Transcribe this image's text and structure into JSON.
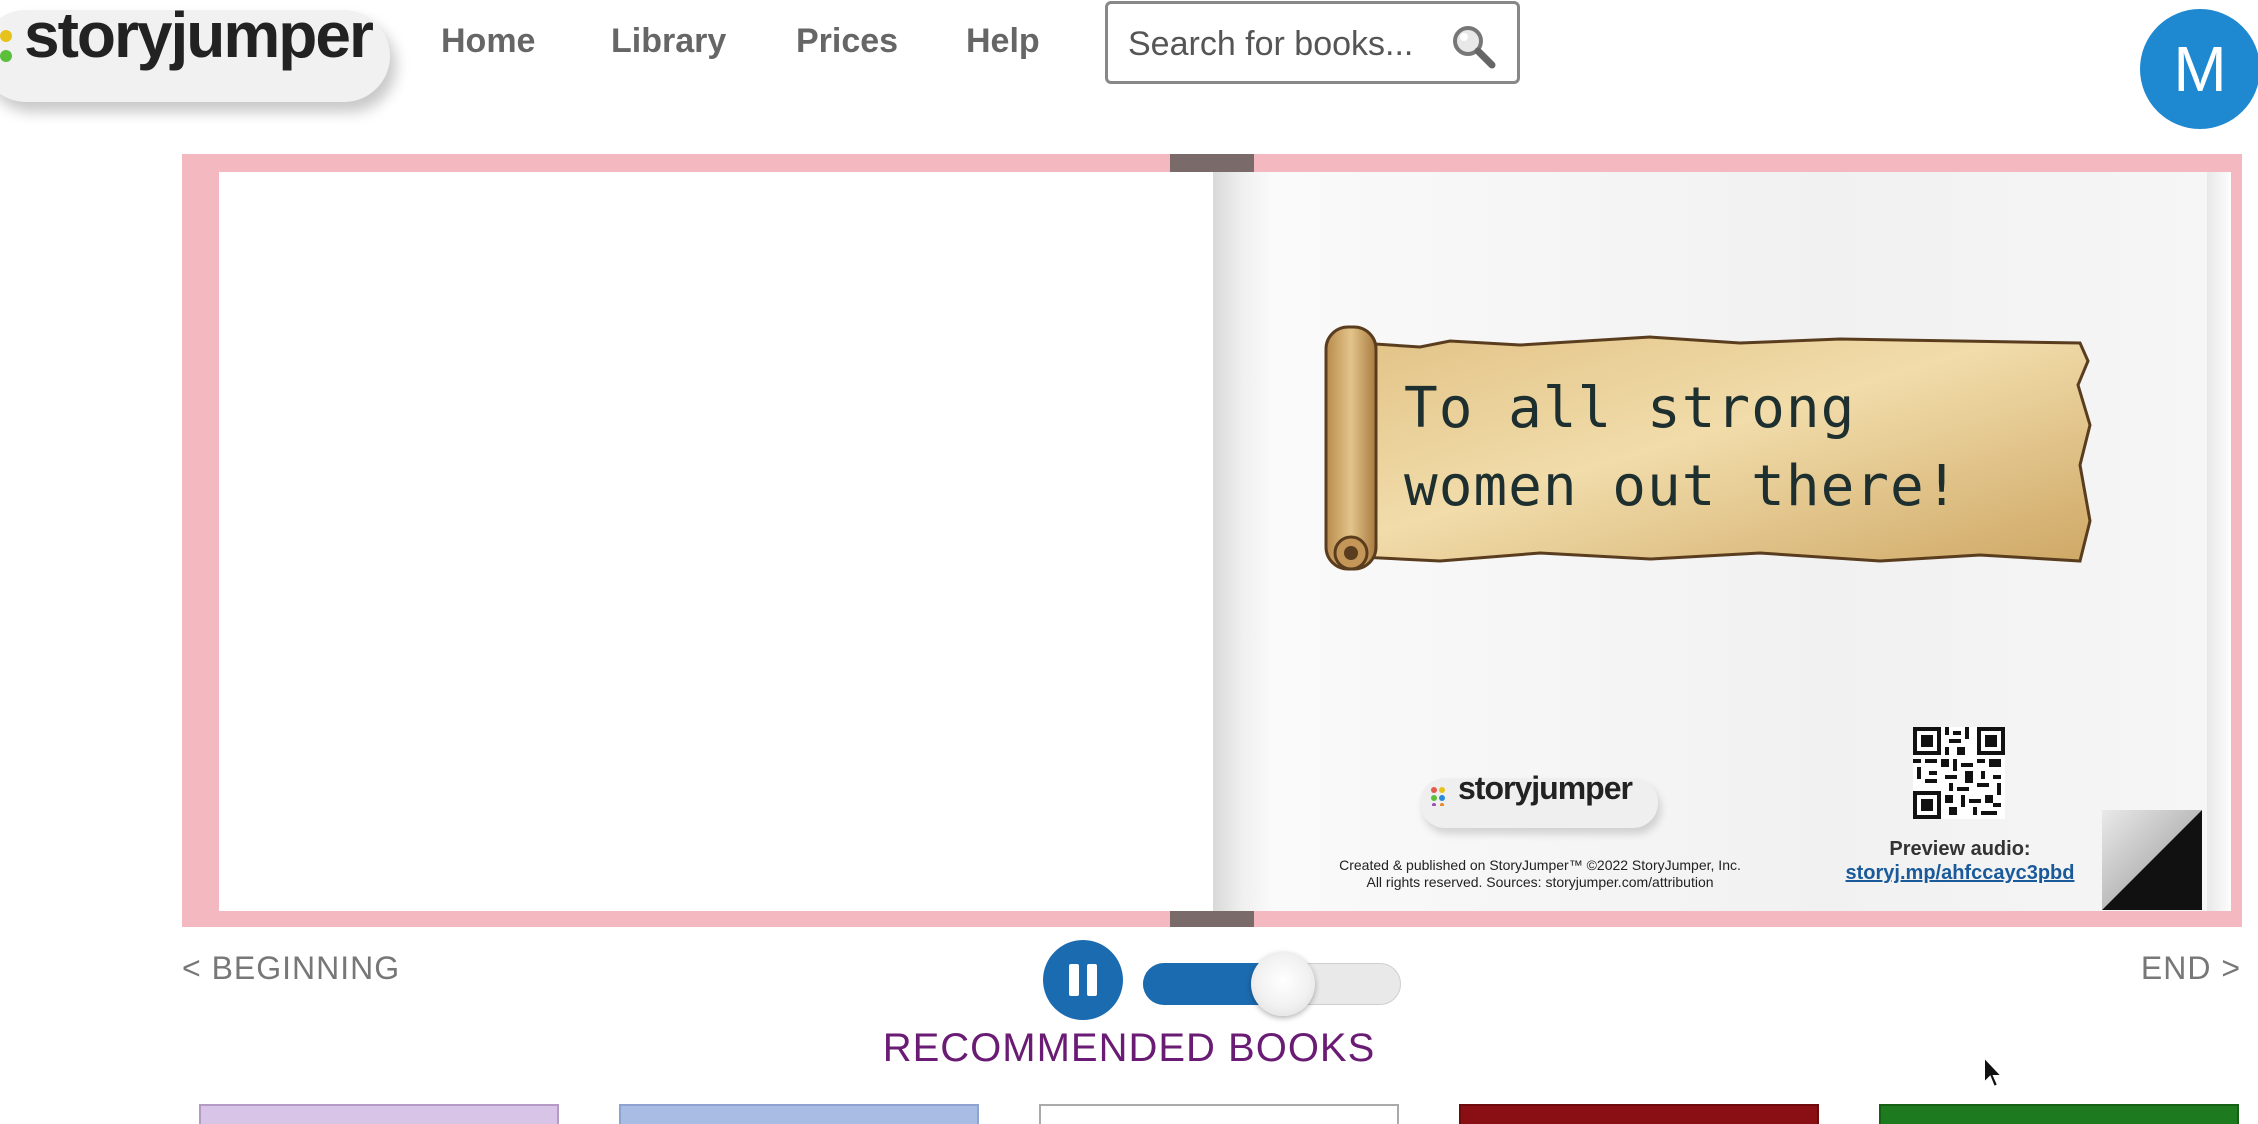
{
  "header": {
    "logo_text": "storyjumper",
    "nav": [
      "Home",
      "Library",
      "Prices",
      "Help"
    ],
    "search_placeholder": "Search for books...",
    "avatar_initial": "M"
  },
  "book": {
    "dedication": [
      "To all strong",
      "women out there!"
    ],
    "publisher_logo_text": "storyjumper",
    "credits": [
      "Created & published on StoryJumper™ ©2022 StoryJumper, Inc.",
      "All rights reserved. Sources: storyjumper.com/attribution"
    ],
    "preview_label": "Preview audio:",
    "preview_link": "storyj.mp/ahfccayc3pbd"
  },
  "controls": {
    "beginning_label": "< BEGINNING",
    "end_label": "END >",
    "audio_progress": 0.42
  },
  "recommended_title": "RECOMMENDED BOOKS",
  "colors": {
    "frame": "#f4b8c1",
    "accent": "#1b6bb0",
    "recommended": "#6a1b74",
    "avatar": "#1e88d0"
  },
  "icons": [
    "search-icon",
    "pause-icon",
    "qr-code-icon",
    "page-curl-icon",
    "mouse-cursor-icon"
  ]
}
